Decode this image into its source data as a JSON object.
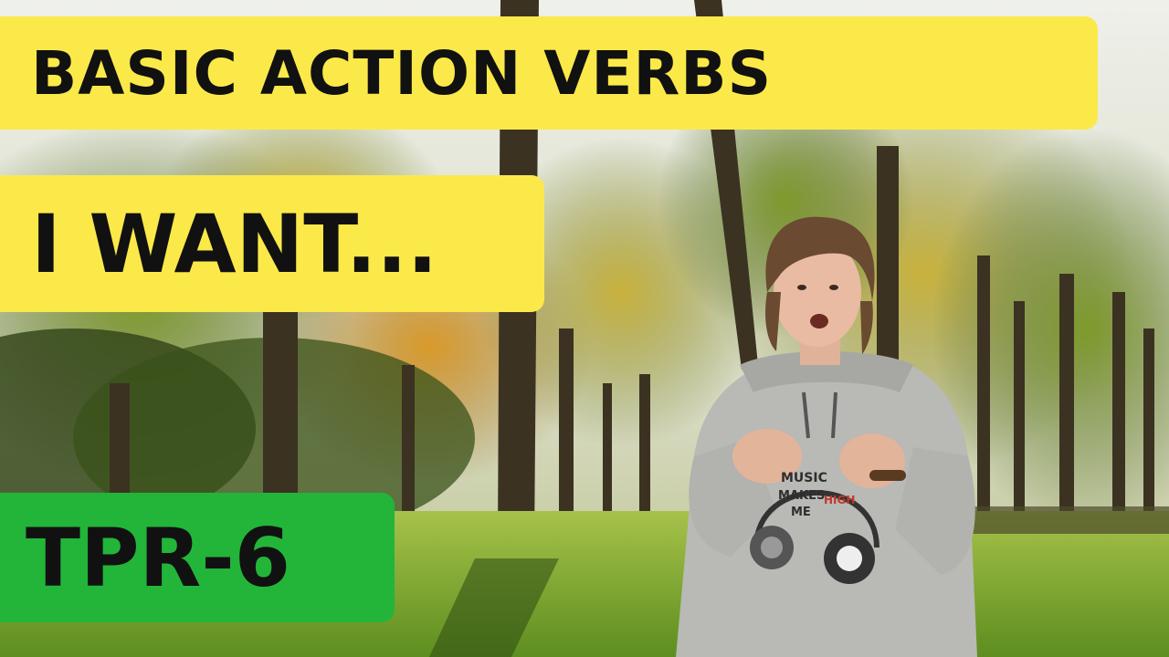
{
  "title": "BASIC ACTION VERBS",
  "subtitle": "I WANT...",
  "badge": "TPR-6",
  "shirt": {
    "line1": "MUSIC",
    "line2": "MAKES",
    "line3": "ME",
    "line4": "HIGH"
  },
  "colors": {
    "banner_yellow": "#fbe94a",
    "badge_green": "#22b53a",
    "text": "#111111"
  }
}
